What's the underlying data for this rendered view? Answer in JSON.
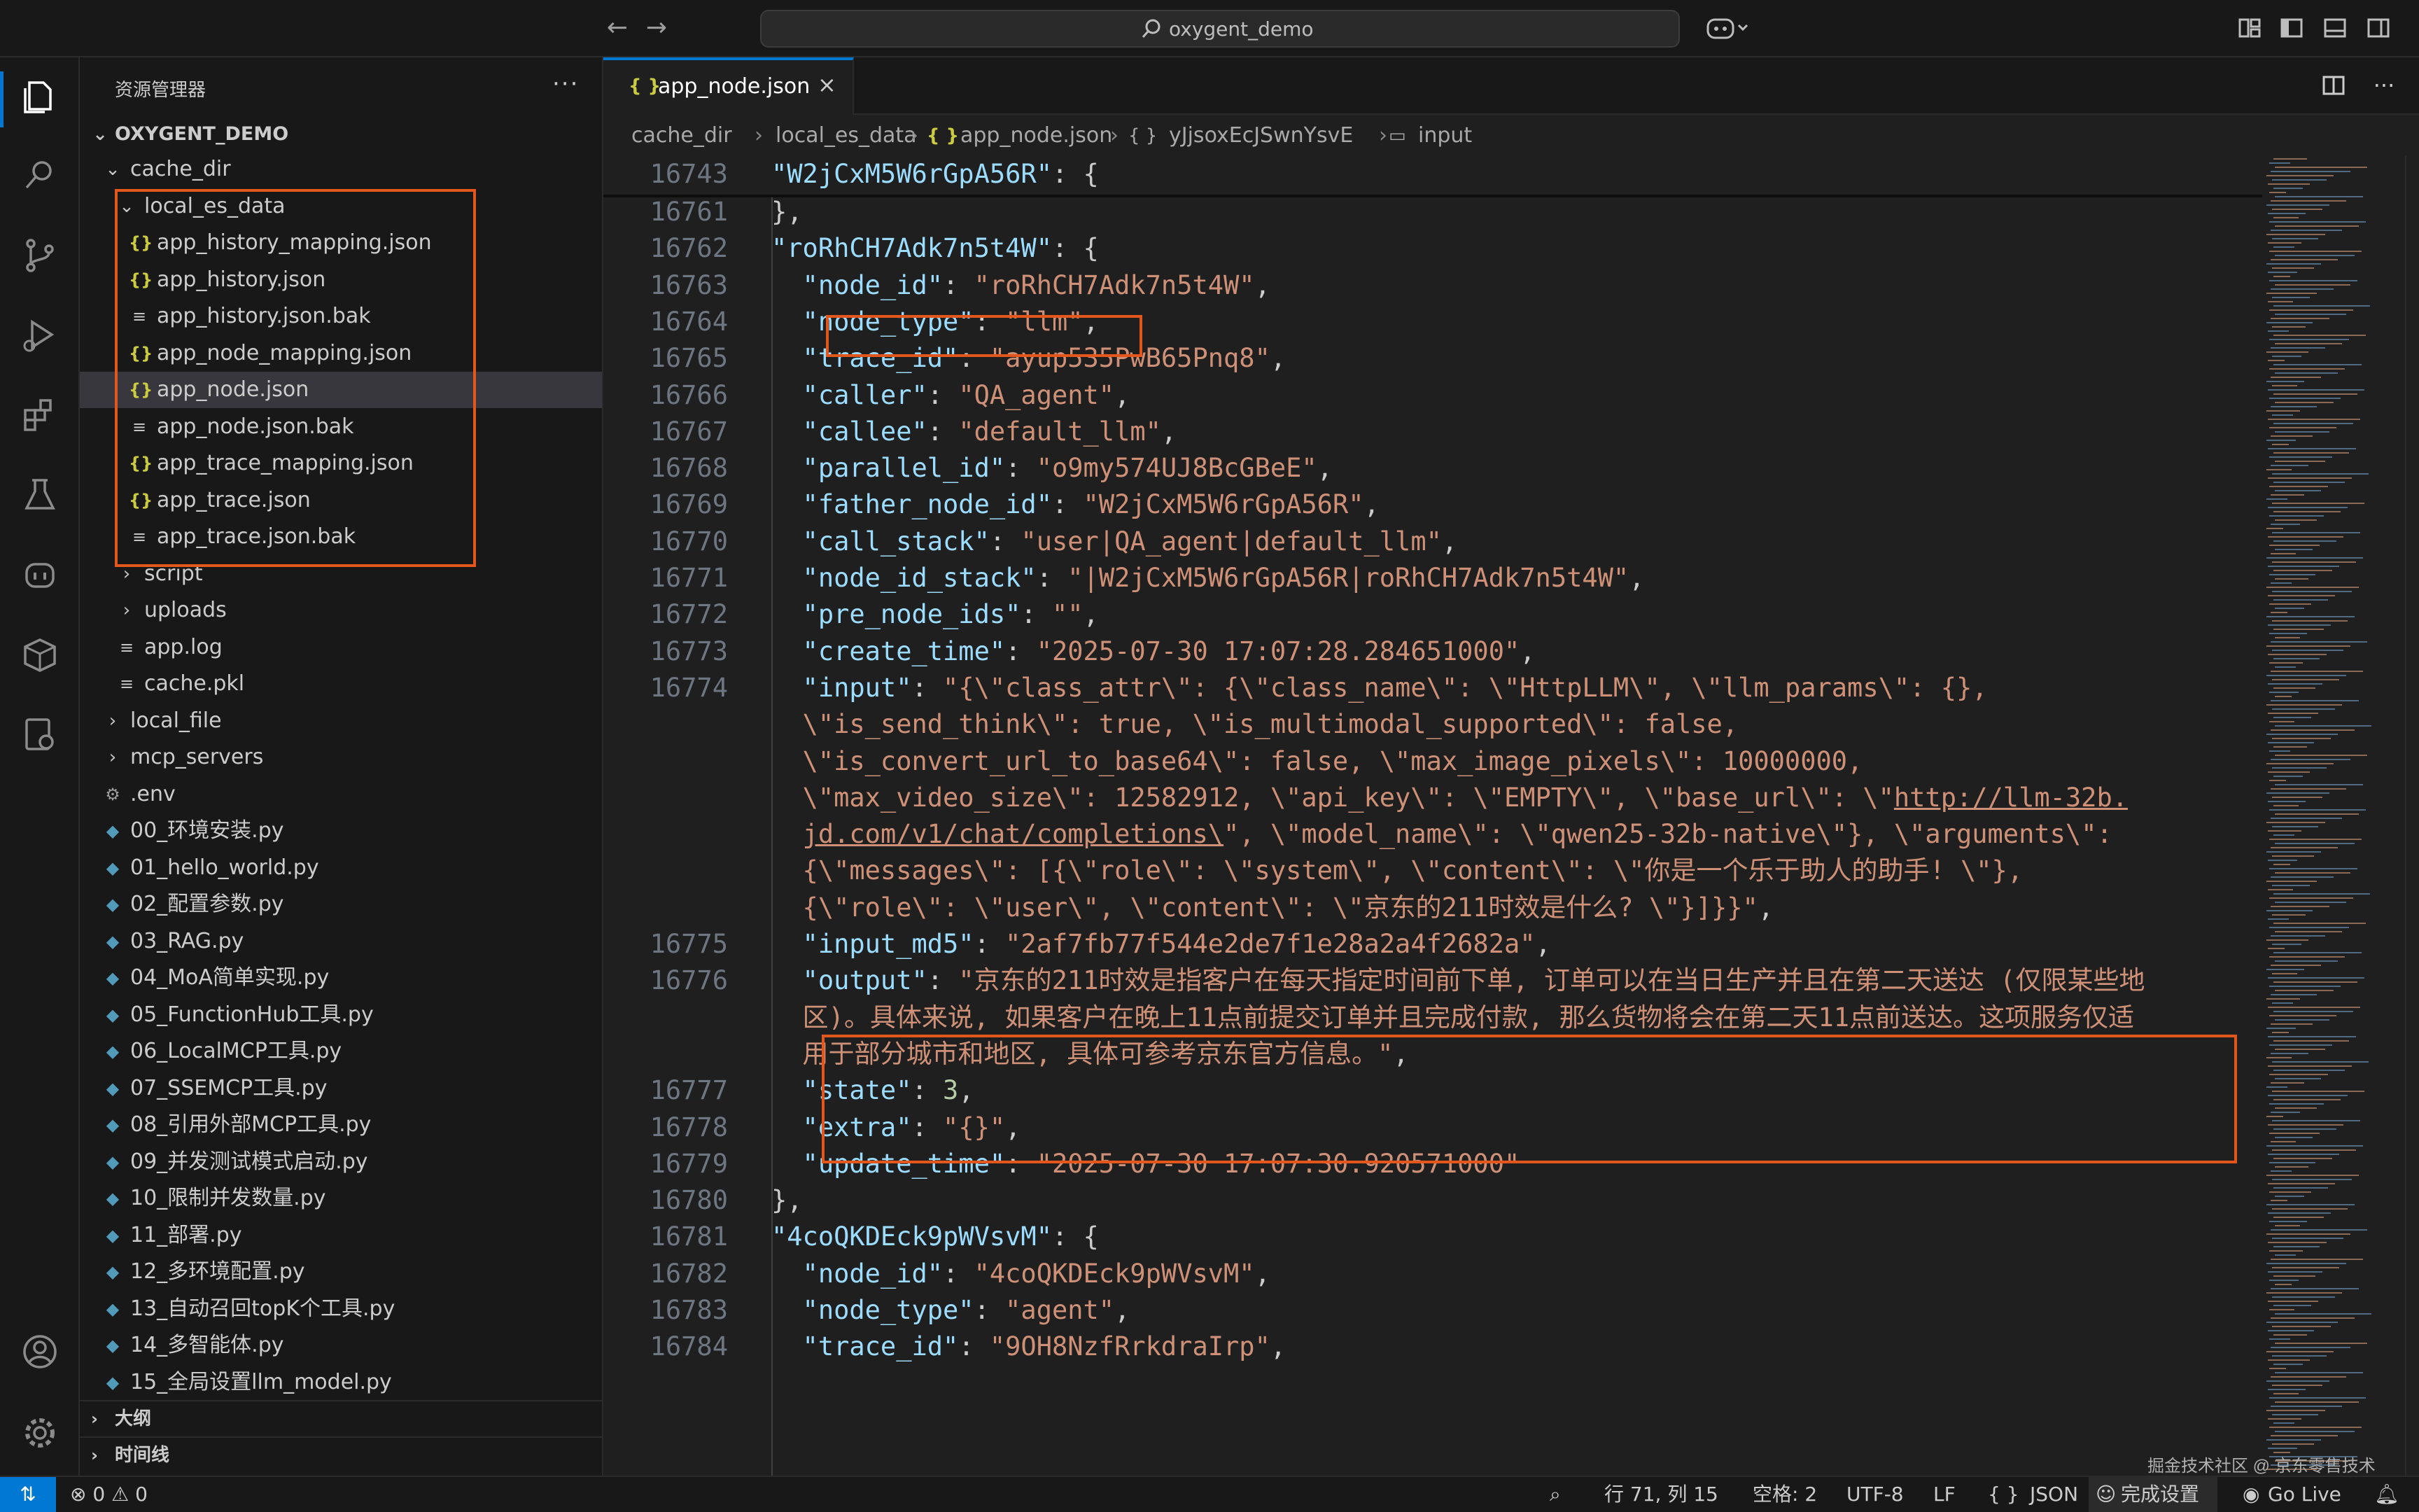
{
  "titlebar": {
    "search_text": "oxygent_demo"
  },
  "sidebar": {
    "title": "资源管理器",
    "more": "···",
    "root": "OXYGENT_DEMO",
    "tree": [
      {
        "label": "cache_dir",
        "kind": "folder-open",
        "depth": 1
      },
      {
        "label": "local_es_data",
        "kind": "folder-open",
        "depth": 2
      },
      {
        "label": "app_history_mapping.json",
        "kind": "json",
        "depth": 3
      },
      {
        "label": "app_history.json",
        "kind": "json",
        "depth": 3
      },
      {
        "label": "app_history.json.bak",
        "kind": "text",
        "depth": 3
      },
      {
        "label": "app_node_mapping.json",
        "kind": "json",
        "depth": 3
      },
      {
        "label": "app_node.json",
        "kind": "json",
        "depth": 3,
        "selected": true
      },
      {
        "label": "app_node.json.bak",
        "kind": "text",
        "depth": 3
      },
      {
        "label": "app_trace_mapping.json",
        "kind": "json",
        "depth": 3
      },
      {
        "label": "app_trace.json",
        "kind": "json",
        "depth": 3
      },
      {
        "label": "app_trace.json.bak",
        "kind": "text",
        "depth": 3
      },
      {
        "label": "script",
        "kind": "folder",
        "depth": 2
      },
      {
        "label": "uploads",
        "kind": "folder",
        "depth": 2
      },
      {
        "label": "app.log",
        "kind": "text",
        "depth": 2
      },
      {
        "label": "cache.pkl",
        "kind": "text",
        "depth": 2
      },
      {
        "label": "local_file",
        "kind": "folder",
        "depth": 1
      },
      {
        "label": "mcp_servers",
        "kind": "folder",
        "depth": 1
      },
      {
        "label": ".env",
        "kind": "env",
        "depth": 1
      },
      {
        "label": "00_环境安装.py",
        "kind": "py",
        "depth": 1
      },
      {
        "label": "01_hello_world.py",
        "kind": "py",
        "depth": 1
      },
      {
        "label": "02_配置参数.py",
        "kind": "py",
        "depth": 1
      },
      {
        "label": "03_RAG.py",
        "kind": "py",
        "depth": 1
      },
      {
        "label": "04_MoA简单实现.py",
        "kind": "py",
        "depth": 1
      },
      {
        "label": "05_FunctionHub工具.py",
        "kind": "py",
        "depth": 1
      },
      {
        "label": "06_LocalMCP工具.py",
        "kind": "py",
        "depth": 1
      },
      {
        "label": "07_SSEMCP工具.py",
        "kind": "py",
        "depth": 1
      },
      {
        "label": "08_引用外部MCP工具.py",
        "kind": "py",
        "depth": 1
      },
      {
        "label": "09_并发测试模式启动.py",
        "kind": "py",
        "depth": 1
      },
      {
        "label": "10_限制并发数量.py",
        "kind": "py",
        "depth": 1
      },
      {
        "label": "11_部署.py",
        "kind": "py",
        "depth": 1
      },
      {
        "label": "12_多环境配置.py",
        "kind": "py",
        "depth": 1
      },
      {
        "label": "13_自动召回topK个工具.py",
        "kind": "py",
        "depth": 1
      },
      {
        "label": "14_多智能体.py",
        "kind": "py",
        "depth": 1
      },
      {
        "label": "15_全局设置llm_model.py",
        "kind": "py",
        "depth": 1
      }
    ],
    "sections": [
      "大纲",
      "时间线"
    ]
  },
  "tab": {
    "label": "app_node.json",
    "icon": "{ }",
    "close": "×"
  },
  "breadcrumb": [
    "cache_dir",
    "local_es_data",
    "app_node.json",
    "yJjsoxEcJSwnYsvE",
    "input"
  ],
  "breadcrumb_icons": [
    "{ }",
    "{ }",
    "▭"
  ],
  "editor": {
    "lines": [
      {
        "ln": "16743",
        "parts": [
          [
            "k",
            "\"W2jCxM5W6rGpA56R\""
          ],
          [
            "p",
            ": {"
          ]
        ]
      },
      {
        "ln": "16761",
        "parts": [
          [
            "p",
            "},"
          ]
        ]
      },
      {
        "ln": "16762",
        "parts": [
          [
            "k",
            "\"roRhCH7Adk7n5t4W\""
          ],
          [
            "p",
            ": {"
          ]
        ]
      },
      {
        "ln": "16763",
        "parts": [
          [
            "k",
            "  \"node_id\""
          ],
          [
            "p",
            ": "
          ],
          [
            "s",
            "\"roRhCH7Adk7n5t4W\""
          ],
          [
            "p",
            ","
          ]
        ]
      },
      {
        "ln": "16764",
        "parts": [
          [
            "k",
            "  \"node_type\""
          ],
          [
            "p",
            ": "
          ],
          [
            "s",
            "\"llm\""
          ],
          [
            "p",
            ","
          ]
        ]
      },
      {
        "ln": "16765",
        "parts": [
          [
            "k",
            "  \"trace_id\""
          ],
          [
            "p",
            ": "
          ],
          [
            "s",
            "\"ayup535PwB65Pnq8\""
          ],
          [
            "p",
            ","
          ]
        ]
      },
      {
        "ln": "16766",
        "parts": [
          [
            "k",
            "  \"caller\""
          ],
          [
            "p",
            ": "
          ],
          [
            "s",
            "\"QA_agent\""
          ],
          [
            "p",
            ","
          ]
        ]
      },
      {
        "ln": "16767",
        "parts": [
          [
            "k",
            "  \"callee\""
          ],
          [
            "p",
            ": "
          ],
          [
            "s",
            "\"default_llm\""
          ],
          [
            "p",
            ","
          ]
        ]
      },
      {
        "ln": "16768",
        "parts": [
          [
            "k",
            "  \"parallel_id\""
          ],
          [
            "p",
            ": "
          ],
          [
            "s",
            "\"o9my574UJ8BcGBeE\""
          ],
          [
            "p",
            ","
          ]
        ]
      },
      {
        "ln": "16769",
        "parts": [
          [
            "k",
            "  \"father_node_id\""
          ],
          [
            "p",
            ": "
          ],
          [
            "s",
            "\"W2jCxM5W6rGpA56R\""
          ],
          [
            "p",
            ","
          ]
        ]
      },
      {
        "ln": "16770",
        "parts": [
          [
            "k",
            "  \"call_stack\""
          ],
          [
            "p",
            ": "
          ],
          [
            "s",
            "\"user|QA_agent|default_llm\""
          ],
          [
            "p",
            ","
          ]
        ]
      },
      {
        "ln": "16771",
        "parts": [
          [
            "k",
            "  \"node_id_stack\""
          ],
          [
            "p",
            ": "
          ],
          [
            "s",
            "\"|W2jCxM5W6rGpA56R|roRhCH7Adk7n5t4W\""
          ],
          [
            "p",
            ","
          ]
        ]
      },
      {
        "ln": "16772",
        "parts": [
          [
            "k",
            "  \"pre_node_ids\""
          ],
          [
            "p",
            ": "
          ],
          [
            "s",
            "\"\""
          ],
          [
            "p",
            ","
          ]
        ]
      },
      {
        "ln": "16773",
        "parts": [
          [
            "k",
            "  \"create_time\""
          ],
          [
            "p",
            ": "
          ],
          [
            "s",
            "\"2025-07-30 17:07:28.284651000\""
          ],
          [
            "p",
            ","
          ]
        ]
      },
      {
        "ln": "16774",
        "parts": [
          [
            "k",
            "  \"input\""
          ],
          [
            "p",
            ": "
          ],
          [
            "s",
            "\"{\\\"class_attr\\\": {\\\"class_name\\\": \\\"HttpLLM\\\", \\\"llm_params\\\": {},"
          ]
        ]
      },
      {
        "ln": "",
        "parts": [
          [
            "s",
            "  \\\"is_send_think\\\": true, \\\"is_multimodal_supported\\\": false,"
          ]
        ]
      },
      {
        "ln": "",
        "parts": [
          [
            "s",
            "  \\\"is_convert_url_to_base64\\\": false, \\\"max_image_pixels\\\": 10000000,"
          ]
        ]
      },
      {
        "ln": "",
        "parts": [
          [
            "s",
            "  \\\"max_video_size\\\": 12582912, \\\"api_key\\\": \\\"EMPTY\\\", \\\"base_url\\\": \\\""
          ],
          [
            "u",
            "http://llm-32b."
          ]
        ]
      },
      {
        "ln": "",
        "parts": [
          [
            "p",
            "  "
          ],
          [
            "u",
            "jd.com/v1/chat/completions\\"
          ],
          [
            "s",
            "\", \\\"model_name\\\": \\\"qwen25-32b-native\\\"}, \\\"arguments\\\":"
          ]
        ]
      },
      {
        "ln": "",
        "parts": [
          [
            "s",
            "  {\\\"messages\\\": [{\\\"role\\\": \\\"system\\\", \\\"content\\\": \\\"你是一个乐于助人的助手! \\\"},"
          ]
        ]
      },
      {
        "ln": "",
        "parts": [
          [
            "s",
            "  {\\\"role\\\": \\\"user\\\", \\\"content\\\": \\\"京东的211时效是什么? \\\"}]}}\""
          ],
          [
            "p",
            ","
          ]
        ]
      },
      {
        "ln": "16775",
        "parts": [
          [
            "k",
            "  \"input_md5\""
          ],
          [
            "p",
            ": "
          ],
          [
            "s",
            "\"2af7fb77f544e2de7f1e28a2a4f2682a\""
          ],
          [
            "p",
            ","
          ]
        ]
      },
      {
        "ln": "16776",
        "parts": [
          [
            "k",
            "  \"output\""
          ],
          [
            "p",
            ": "
          ],
          [
            "s",
            "\"京东的211时效是指客户在每天指定时间前下单, 订单可以在当日生产并且在第二天送达 (仅限某些地"
          ]
        ]
      },
      {
        "ln": "",
        "parts": [
          [
            "s",
            "  区)。具体来说, 如果客户在晚上11点前提交订单并且完成付款, 那么货物将会在第二天11点前送达。这项服务仅适"
          ]
        ]
      },
      {
        "ln": "",
        "parts": [
          [
            "s",
            "  用于部分城市和地区, 具体可参考京东官方信息。\""
          ],
          [
            "p",
            ","
          ]
        ]
      },
      {
        "ln": "16777",
        "parts": [
          [
            "k",
            "  \"state\""
          ],
          [
            "p",
            ": "
          ],
          [
            "n",
            "3"
          ],
          [
            "p",
            ","
          ]
        ]
      },
      {
        "ln": "16778",
        "parts": [
          [
            "k",
            "  \"extra\""
          ],
          [
            "p",
            ": "
          ],
          [
            "s",
            "\"{}\""
          ],
          [
            "p",
            ","
          ]
        ]
      },
      {
        "ln": "16779",
        "parts": [
          [
            "k",
            "  \"update_time\""
          ],
          [
            "p",
            ": "
          ],
          [
            "s",
            "\"2025-07-30 17:07:30.920571000\""
          ]
        ]
      },
      {
        "ln": "16780",
        "parts": [
          [
            "p",
            "},"
          ]
        ]
      },
      {
        "ln": "16781",
        "parts": [
          [
            "k",
            "\"4coQKDEck9pWVsvM\""
          ],
          [
            "p",
            ": {"
          ]
        ]
      },
      {
        "ln": "16782",
        "parts": [
          [
            "k",
            "  \"node_id\""
          ],
          [
            "p",
            ": "
          ],
          [
            "s",
            "\"4coQKDEck9pWVsvM\""
          ],
          [
            "p",
            ","
          ]
        ]
      },
      {
        "ln": "16783",
        "parts": [
          [
            "k",
            "  \"node_type\""
          ],
          [
            "p",
            ": "
          ],
          [
            "s",
            "\"agent\""
          ],
          [
            "p",
            ","
          ]
        ]
      },
      {
        "ln": "16784",
        "parts": [
          [
            "k",
            "  \"trace_id\""
          ],
          [
            "p",
            ": "
          ],
          [
            "s",
            "\"9OH8NzfRrkdraIrp\""
          ],
          [
            "p",
            ","
          ]
        ]
      }
    ]
  },
  "watermark": "掘金技术社区 @ 京东零售技术",
  "statusbar": {
    "problems": "⊗ 0 ⚠ 0",
    "position": "行 71, 列 15",
    "spaces": "空格: 2",
    "encoding": "UTF-8",
    "eol": "LF",
    "language": "JSON",
    "copilot": "完成设置",
    "golive": "Go Live"
  },
  "colors": {
    "highlight": "#e4571c",
    "accent": "#0078d4"
  }
}
